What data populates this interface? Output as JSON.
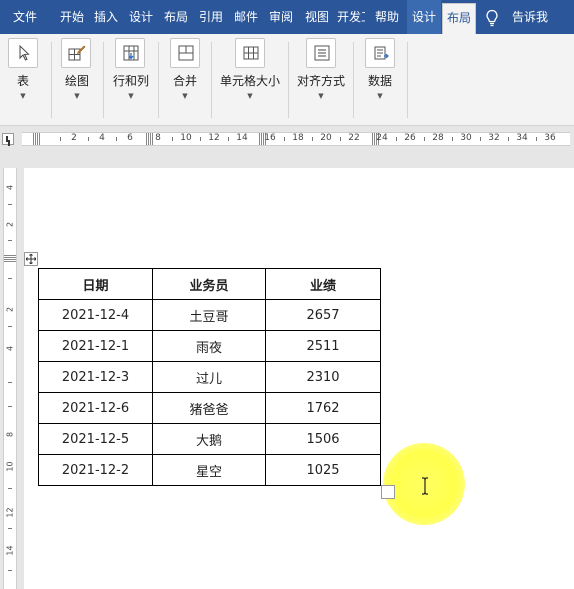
{
  "ribbon_tabs": [
    {
      "label": "文件"
    },
    {
      "label": "开始"
    },
    {
      "label": "插入"
    },
    {
      "label": "设计"
    },
    {
      "label": "布局"
    },
    {
      "label": "引用"
    },
    {
      "label": "邮件"
    },
    {
      "label": "审阅"
    },
    {
      "label": "视图"
    },
    {
      "label": "开发工具"
    },
    {
      "label": "帮助"
    },
    {
      "label": "设计"
    },
    {
      "label": "布局"
    },
    {
      "label": "告诉我"
    }
  ],
  "ribbon_groups": [
    {
      "label": "表",
      "icon": "table-select-icon"
    },
    {
      "label": "绘图",
      "icon": "draw-table-icon"
    },
    {
      "label": "行和列",
      "icon": "rows-columns-icon"
    },
    {
      "label": "合并",
      "icon": "merge-cells-icon"
    },
    {
      "label": "单元格大小",
      "icon": "cell-size-icon"
    },
    {
      "label": "对齐方式",
      "icon": "alignment-icon"
    },
    {
      "label": "数据",
      "icon": "data-icon"
    }
  ],
  "ruler_numbers": [
    "2",
    "4",
    "6",
    "8",
    "10",
    "12",
    "14",
    "16",
    "18",
    "20",
    "22",
    "24",
    "26",
    "28",
    "30",
    "32",
    "34",
    "36"
  ],
  "vruler_numbers": [
    "4",
    "2",
    "2",
    "4",
    "8",
    "10",
    "12",
    "14"
  ],
  "table": {
    "headers": [
      "日期",
      "业务员",
      "业绩"
    ],
    "rows": [
      [
        "2021-12-4",
        "土豆哥",
        "2657"
      ],
      [
        "2021-12-1",
        "雨夜",
        "2511"
      ],
      [
        "2021-12-3",
        "过儿",
        "2310"
      ],
      [
        "2021-12-6",
        "猪爸爸",
        "1762"
      ],
      [
        "2021-12-5",
        "大鹅",
        "1506"
      ],
      [
        "2021-12-2",
        "星空",
        "1025"
      ]
    ]
  },
  "colors": {
    "title_bar": "#2b579a",
    "ribbon": "#f3f3f3",
    "highlight": "#ffff5a"
  }
}
